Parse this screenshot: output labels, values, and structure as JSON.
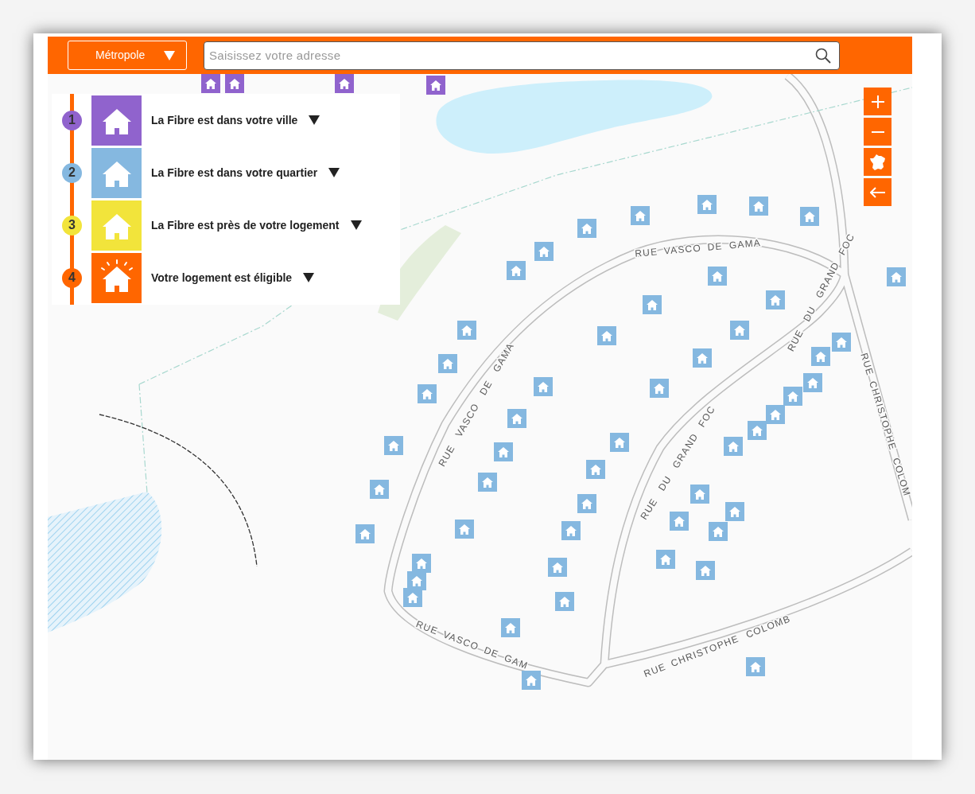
{
  "header": {
    "region_select": {
      "label": "Métropole"
    },
    "search": {
      "placeholder": "Saisissez votre adresse"
    }
  },
  "legend": [
    {
      "number": "1",
      "label": "La Fibre est dans votre ville",
      "color": "#9063cd",
      "kind": "house"
    },
    {
      "number": "2",
      "label": "La Fibre est dans votre quartier",
      "color": "#85b8e0",
      "kind": "house"
    },
    {
      "number": "3",
      "label": "La Fibre est près de votre logement",
      "color": "#f2e43b",
      "kind": "house"
    },
    {
      "number": "4",
      "label": "Votre logement est éligible",
      "color": "#ff6600",
      "kind": "house-rays"
    }
  ],
  "map": {
    "street_labels": [
      "RUE VASCO DE GAMA",
      "RUE VASCO DE GAMA",
      "RUE VASCO DE GAM",
      "RUE DU GRAND FOC",
      "RUE DU GRAND FOC",
      "RUE CHRISTOPHE COLOMB",
      "RUE CHRISTOPHE COLOM"
    ]
  }
}
